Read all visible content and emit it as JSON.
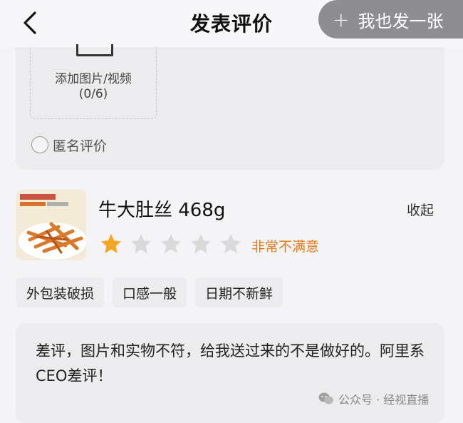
{
  "header": {
    "title": "发表评价",
    "post_button_label": "我也发一张"
  },
  "upload": {
    "label": "添加图片/视频",
    "count": "(0/6)"
  },
  "anonymous": {
    "label": "匿名评价",
    "checked": false
  },
  "product": {
    "name": "牛大肚丝 468g",
    "collapse_label": "收起",
    "rating": 1,
    "max_rating": 5,
    "rating_text": "非常不满意"
  },
  "tags": [
    "外包装破损",
    "口感一般",
    "日期不新鲜"
  ],
  "comment": {
    "text": "差评，图片和实物不符，给我送过来的不是做好的。阿里系CEO差评！"
  },
  "watermark": {
    "text": "公众号 · 经视直播"
  },
  "colors": {
    "accent": "#e07a1a",
    "star_active": "#f5a623",
    "star_inactive": "#d9d9db"
  }
}
